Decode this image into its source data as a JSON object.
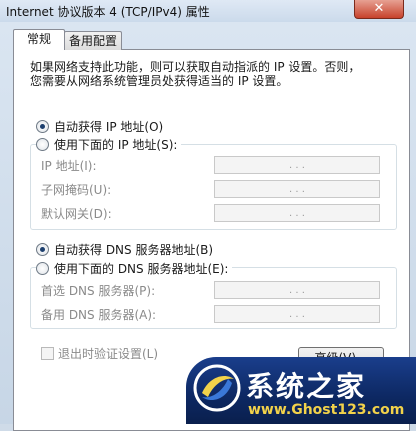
{
  "window": {
    "title": "Internet 协议版本 4 (TCP/IPv4) 属性",
    "close_glyph": "✕"
  },
  "tabs": [
    {
      "label": "常规",
      "selected": true
    },
    {
      "label": "备用配置",
      "selected": false
    }
  ],
  "description": {
    "line1": "如果网络支持此功能，则可以获取自动指派的 IP 设置。否则，",
    "line2": "您需要从网络系统管理员处获得适当的 IP 设置。"
  },
  "ip_section": {
    "auto_option": "自动获得 IP 地址(O)",
    "manual_option": "使用下面的 IP 地址(S):",
    "auto_selected": true,
    "fields": [
      {
        "label": "IP 地址(I):",
        "value": ". . ."
      },
      {
        "label": "子网掩码(U):",
        "value": ". . ."
      },
      {
        "label": "默认网关(D):",
        "value": ". . ."
      }
    ]
  },
  "dns_section": {
    "auto_option": "自动获得 DNS 服务器地址(B)",
    "manual_option": "使用下面的 DNS 服务器地址(E):",
    "auto_selected": true,
    "fields": [
      {
        "label": "首选 DNS 服务器(P):",
        "value": ". . ."
      },
      {
        "label": "备用 DNS 服务器(A):",
        "value": ". . ."
      }
    ]
  },
  "footer": {
    "validate_checkbox": "退出时验证设置(L)",
    "validate_checked": false,
    "advanced_button": "高级(V)..."
  },
  "watermark": {
    "title": "系统之家",
    "url": "www.Ghost123.com"
  },
  "colors": {
    "watermark_bg": "#0d2862",
    "watermark_url": "#f2d24a",
    "close_button": "#c7422c"
  }
}
